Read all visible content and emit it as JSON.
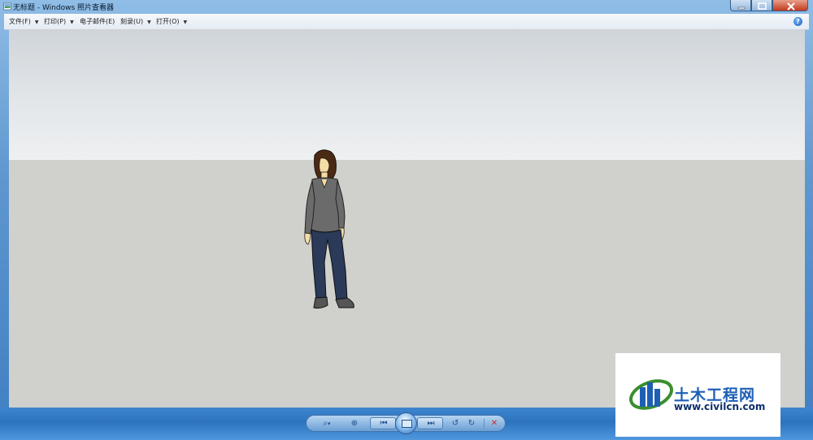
{
  "window": {
    "title": "无标题 - Windows 照片查看器"
  },
  "menu": {
    "items": [
      {
        "label": "文件(F)",
        "has_dropdown": true
      },
      {
        "label": "打印(P)",
        "has_dropdown": true
      },
      {
        "label": "电子邮件(E)",
        "has_dropdown": false
      },
      {
        "label": "刻录(U)",
        "has_dropdown": true
      },
      {
        "label": "打开(O)",
        "has_dropdown": true
      }
    ],
    "caret": "▼",
    "help_glyph": "?"
  },
  "viewer": {
    "image_description_icon": "person-figure",
    "sky_color": "#e3e6e9",
    "ground_color": "#d0d1cc"
  },
  "controls": {
    "zoom_glyph": "⌕",
    "zoom_caret": "▾",
    "fit_glyph": "⊕",
    "prev_glyph": "⏮",
    "next_glyph": "⏭",
    "rotate_ccw_glyph": "↺",
    "rotate_cw_glyph": "↻",
    "delete_glyph": "✕",
    "delete_color": "#d62b1e"
  },
  "watermark": {
    "title": "土木工程网",
    "url": "www.civilcn.com"
  }
}
